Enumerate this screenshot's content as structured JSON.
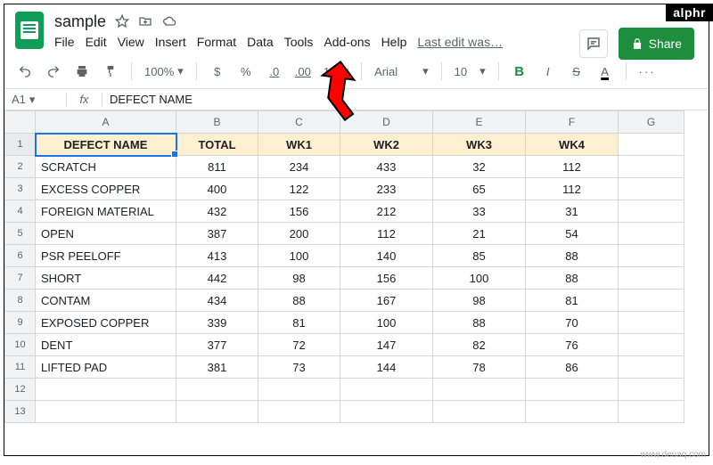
{
  "doc": {
    "title": "sample"
  },
  "menu": {
    "file": "File",
    "edit": "Edit",
    "view": "View",
    "insert": "Insert",
    "format": "Format",
    "data": "Data",
    "tools": "Tools",
    "addons": "Add-ons",
    "help": "Help",
    "lastedit": "Last edit was…"
  },
  "actions": {
    "share": "Share"
  },
  "toolbar": {
    "zoom": "100%",
    "currency": "$",
    "percent": "%",
    "dec_dec": ".0",
    "dec_inc": ".00",
    "numfmt": "123",
    "font": "Arial",
    "fontsize": "10",
    "bold": "B",
    "italic": "I",
    "strike": "S",
    "textcolor": "A",
    "more": "···"
  },
  "fx": {
    "namebox": "A1",
    "symbol": "fx",
    "formula": "DEFECT NAME"
  },
  "chart_data": {
    "type": "table",
    "columns": [
      "DEFECT NAME",
      "TOTAL",
      "WK1",
      "WK2",
      "WK3",
      "WK4"
    ],
    "rows": [
      [
        "SCRATCH",
        811,
        234,
        433,
        32,
        112
      ],
      [
        "EXCESS COPPER",
        400,
        122,
        233,
        65,
        112
      ],
      [
        "FOREIGN MATERIAL",
        432,
        156,
        212,
        33,
        31
      ],
      [
        "OPEN",
        387,
        200,
        112,
        21,
        54
      ],
      [
        "PSR PEELOFF",
        413,
        100,
        140,
        85,
        88
      ],
      [
        "SHORT",
        442,
        98,
        156,
        100,
        88
      ],
      [
        "CONTAM",
        434,
        88,
        167,
        98,
        81
      ],
      [
        "EXPOSED COPPER",
        339,
        81,
        100,
        88,
        70
      ],
      [
        "DENT",
        377,
        72,
        147,
        82,
        76
      ],
      [
        "LIFTED PAD",
        381,
        73,
        144,
        78,
        86
      ]
    ]
  },
  "cols": [
    "A",
    "B",
    "C",
    "D",
    "E",
    "F",
    "G"
  ],
  "rownums": [
    "1",
    "2",
    "3",
    "4",
    "5",
    "6",
    "7",
    "8",
    "9",
    "10",
    "11",
    "12",
    "13"
  ],
  "watermarks": {
    "top": "alphr",
    "bottom": "www.deuaq.com"
  }
}
